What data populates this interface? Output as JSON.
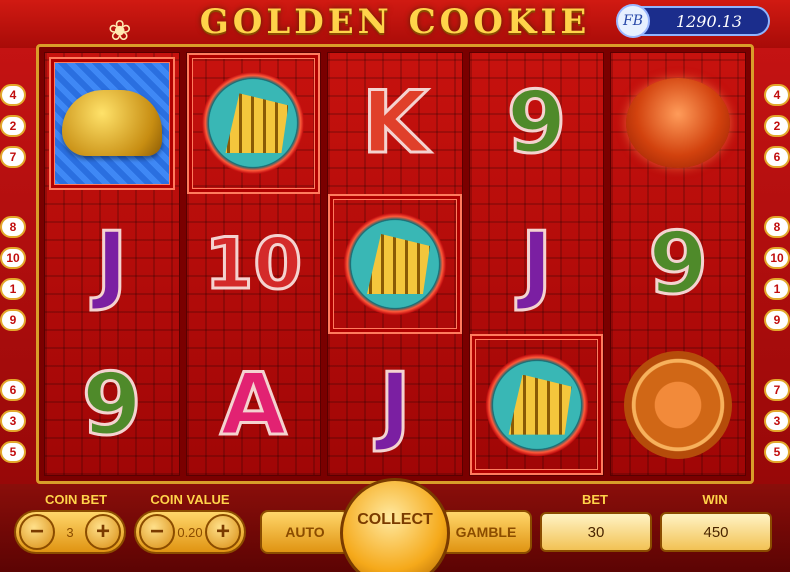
{
  "header": {
    "title": "GOLDEN COOKIE",
    "logo_text": "FB",
    "balance": "1290.13"
  },
  "paylines": {
    "left": [
      "4",
      "2",
      "7",
      "8",
      "10",
      "1",
      "9",
      "6",
      "3",
      "5"
    ],
    "right": [
      "4",
      "2",
      "6",
      "8",
      "10",
      "1",
      "9",
      "7",
      "3",
      "5"
    ]
  },
  "reels": [
    [
      {
        "symbol": "cookie",
        "win": true
      },
      {
        "symbol": "J"
      },
      {
        "symbol": "9"
      }
    ],
    [
      {
        "symbol": "ship",
        "win": true
      },
      {
        "symbol": "10"
      },
      {
        "symbol": "A"
      }
    ],
    [
      {
        "symbol": "K"
      },
      {
        "symbol": "ship",
        "win": true
      },
      {
        "symbol": "J"
      }
    ],
    [
      {
        "symbol": "9"
      },
      {
        "symbol": "J"
      },
      {
        "symbol": "ship",
        "win": true
      }
    ],
    [
      {
        "symbol": "bowl"
      },
      {
        "symbol": "9"
      },
      {
        "symbol": "coin"
      }
    ]
  ],
  "controls": {
    "coin_bet_label": "COIN BET",
    "coin_bet_value": "3",
    "coin_value_label": "COIN VALUE",
    "coin_value_value": "0.20",
    "auto_label": "AUTO",
    "collect_label": "COLLECT",
    "gamble_label": "GAMBLE",
    "bet_label": "BET",
    "bet_value": "30",
    "win_label": "WIN",
    "win_value": "450",
    "minus_symbol": "−",
    "plus_symbol": "+"
  },
  "colors": {
    "background": "#c91414",
    "gold": "#ffd34a",
    "frame": "#d99d2a"
  },
  "icons": {
    "minus": "minus-icon",
    "plus": "plus-icon",
    "swirl": "cloud-swirl-icon"
  }
}
